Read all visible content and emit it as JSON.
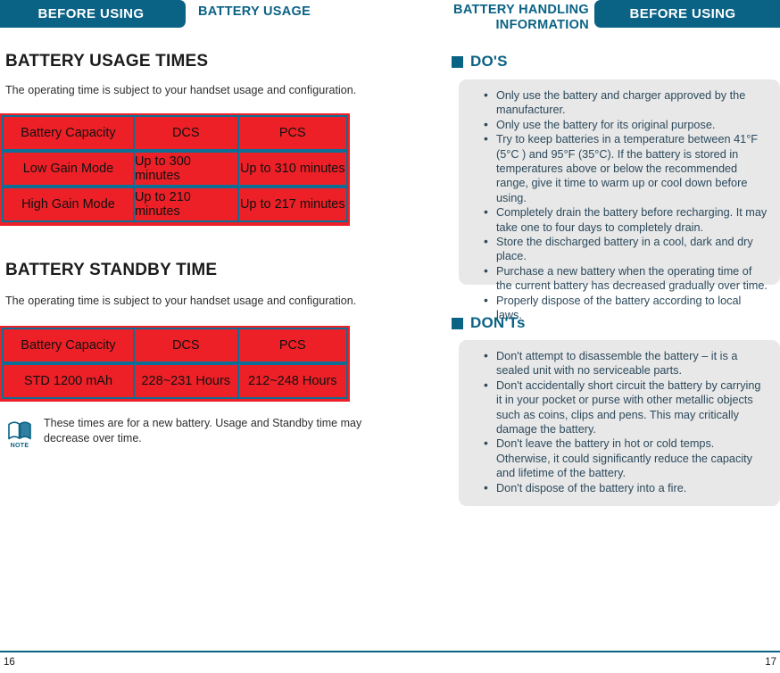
{
  "header": {
    "left_tab": "BEFORE USING",
    "left_section": "BATTERY USAGE",
    "right_section_line1": "BATTERY HANDLING",
    "right_section_line2": "INFORMATION",
    "right_tab": "BEFORE USING"
  },
  "colors": {
    "brand_teal": "#0a6285",
    "table_red": "#ee2027",
    "table_grid": "#0d6f96",
    "gray_box": "#e8e8e8",
    "body_text": "#2c4a5c"
  },
  "left_page": {
    "usage": {
      "heading": "BATTERY USAGE TIMES",
      "subtext": "The operating time is subject to your handset usage and configuration.",
      "table": {
        "headers": [
          "Battery Capacity",
          "DCS",
          "PCS"
        ],
        "rows": [
          [
            "Low Gain Mode",
            "Up to 300 minutes",
            "Up to 310 minutes"
          ],
          [
            "High Gain Mode",
            "Up to 210 minutes",
            "Up to 217 minutes"
          ]
        ]
      }
    },
    "standby": {
      "heading": "BATTERY STANDBY TIME",
      "subtext": "The operating time is subject to your handset usage and configuration.",
      "table": {
        "headers": [
          "Battery Capacity",
          "DCS",
          "PCS"
        ],
        "rows": [
          [
            "STD 1200 mAh",
            "228~231 Hours",
            "212~248 Hours"
          ]
        ]
      }
    },
    "note": {
      "icon_label": "NOTE",
      "text": "These times are for a new battery. Usage and Standby time may decrease over time."
    }
  },
  "right_page": {
    "dos": {
      "heading": "DO'S",
      "items": [
        "Only use the battery and charger approved by the manufacturer.",
        "Only use the battery for its original purpose.",
        "Try to keep batteries in a temperature between 41°F (5°C ) and 95°F (35°C). If the battery is stored in temperatures above or below the recommended range, give it time to warm up or cool down before using.",
        "Completely drain the battery before recharging. It may take one to four days to completely drain.",
        "Store the discharged battery in a cool, dark and dry place.",
        "Purchase a new battery when the operating time of the current battery has decreased gradually over time.",
        "Properly dispose of the battery according to local laws."
      ]
    },
    "donts": {
      "heading": "DON'Ts",
      "items": [
        "Don't attempt to disassemble the battery – it is a sealed unit with no serviceable parts.",
        "Don't accidentally short circuit the battery by carrying it in your pocket or purse with other metallic objects such as coins, clips and pens. This may critically damage the battery.",
        "Don't leave the battery in hot or cold temps. Otherwise, it could significantly reduce the capacity and lifetime of the battery.",
        "Don't dispose of the battery into a fire."
      ]
    }
  },
  "footer": {
    "page_left": "16",
    "page_right": "17"
  }
}
